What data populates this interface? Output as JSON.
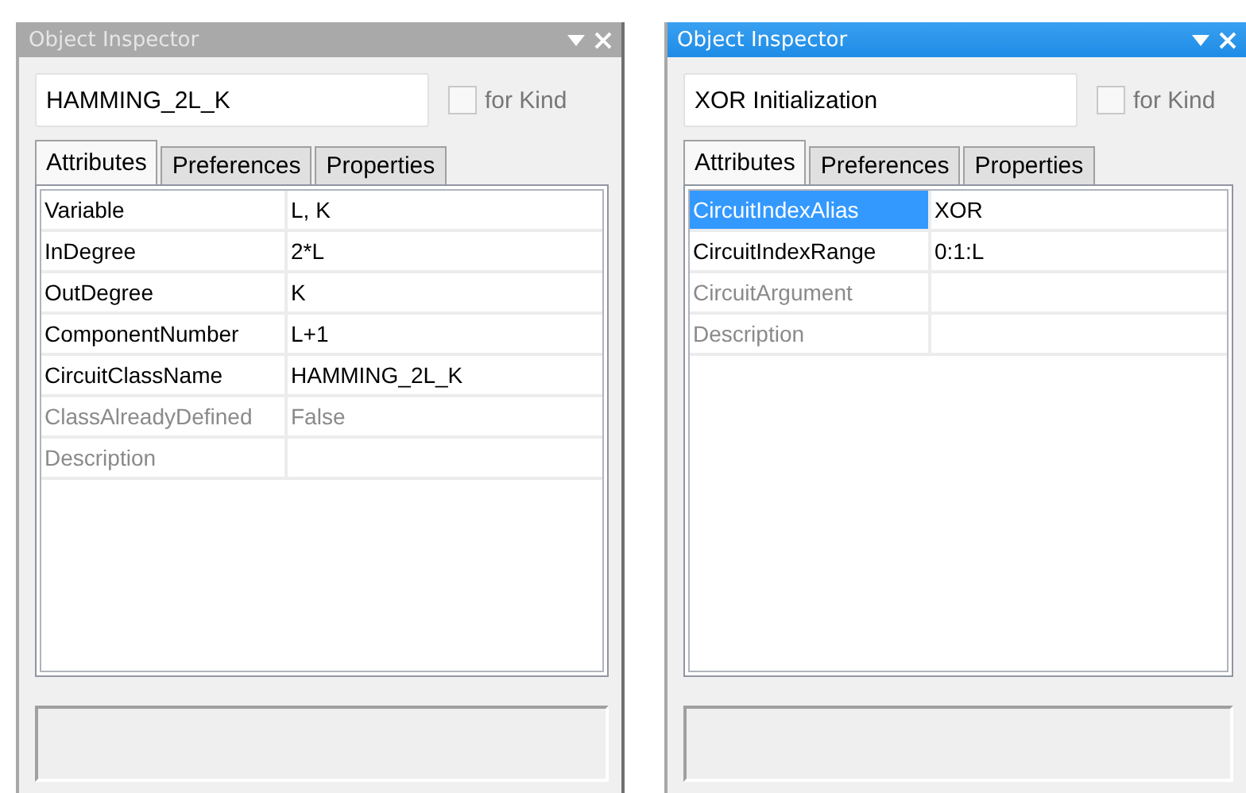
{
  "panels": [
    {
      "title": "Object Inspector",
      "active": false,
      "name_value": "HAMMING_2L_K",
      "for_kind": {
        "label": "for Kind",
        "checked": false
      },
      "tabs": [
        {
          "label": "Attributes",
          "selected": true
        },
        {
          "label": "Preferences",
          "selected": false
        },
        {
          "label": "Properties",
          "selected": false
        }
      ],
      "rows": [
        {
          "name": "Variable",
          "value": "L, K",
          "disabled": false,
          "selected": false
        },
        {
          "name": "InDegree",
          "value": "2*L",
          "disabled": false,
          "selected": false
        },
        {
          "name": "OutDegree",
          "value": "K",
          "disabled": false,
          "selected": false
        },
        {
          "name": "ComponentNumber",
          "value": "L+1",
          "disabled": false,
          "selected": false
        },
        {
          "name": "CircuitClassName",
          "value": "HAMMING_2L_K",
          "disabled": false,
          "selected": false
        },
        {
          "name": "ClassAlreadyDefined",
          "value": "False",
          "disabled": true,
          "selected": false
        },
        {
          "name": "Description",
          "disabled": true,
          "selected": false
        }
      ]
    },
    {
      "title": "Object Inspector",
      "active": true,
      "name_value": "XOR Initialization",
      "for_kind": {
        "label": "for Kind",
        "checked": false
      },
      "tabs": [
        {
          "label": "Attributes",
          "selected": true
        },
        {
          "label": "Preferences",
          "selected": false
        },
        {
          "label": "Properties",
          "selected": false
        }
      ],
      "rows": [
        {
          "name": "CircuitIndexAlias",
          "value": "XOR",
          "disabled": false,
          "selected": true
        },
        {
          "name": "CircuitIndexRange",
          "value": "0:1:L",
          "disabled": false,
          "selected": false
        },
        {
          "name": "CircuitArgument",
          "disabled": true,
          "selected": false
        },
        {
          "name": "Description",
          "disabled": true,
          "selected": false
        }
      ]
    }
  ]
}
